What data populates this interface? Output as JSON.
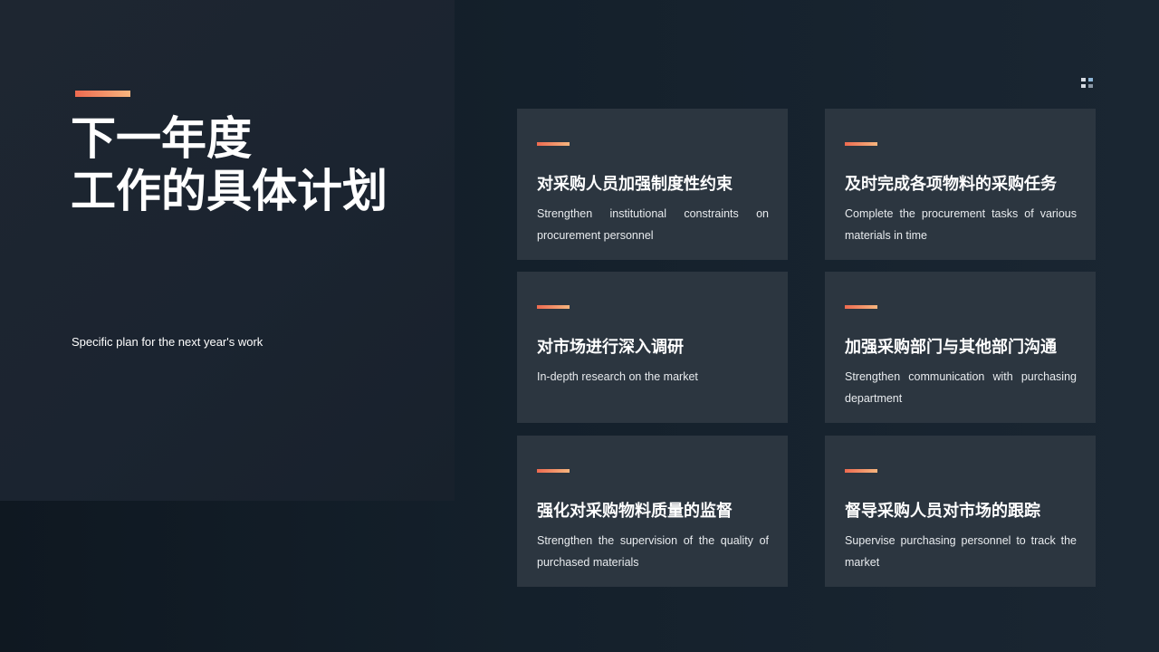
{
  "slide": {
    "title_line1": "下一年度",
    "title_line2": "工作的具体计划",
    "subtitle": "Specific plan for the next year's work"
  },
  "colors": {
    "accent_start": "#ee6a50",
    "accent_end": "#f7b57e",
    "card_bg": "#2c3640",
    "page_bg": "#14202b"
  },
  "icons": {
    "corner": "grid-icon"
  },
  "cards": [
    {
      "title": "对采购人员加强制度性约束",
      "desc": "Strengthen institutional constraints on procurement personnel"
    },
    {
      "title": "及时完成各项物料的采购任务",
      "desc": "Complete the procurement tasks of various materials in time"
    },
    {
      "title": "对市场进行深入调研",
      "desc": "In-depth research on the market"
    },
    {
      "title": "加强采购部门与其他部门沟通",
      "desc": "Strengthen communication with purchasing department"
    },
    {
      "title": "强化对采购物料质量的监督",
      "desc": "Strengthen the supervision of the quality of purchased materials"
    },
    {
      "title": "督导采购人员对市场的跟踪",
      "desc": "Supervise purchasing personnel to track the market"
    }
  ]
}
